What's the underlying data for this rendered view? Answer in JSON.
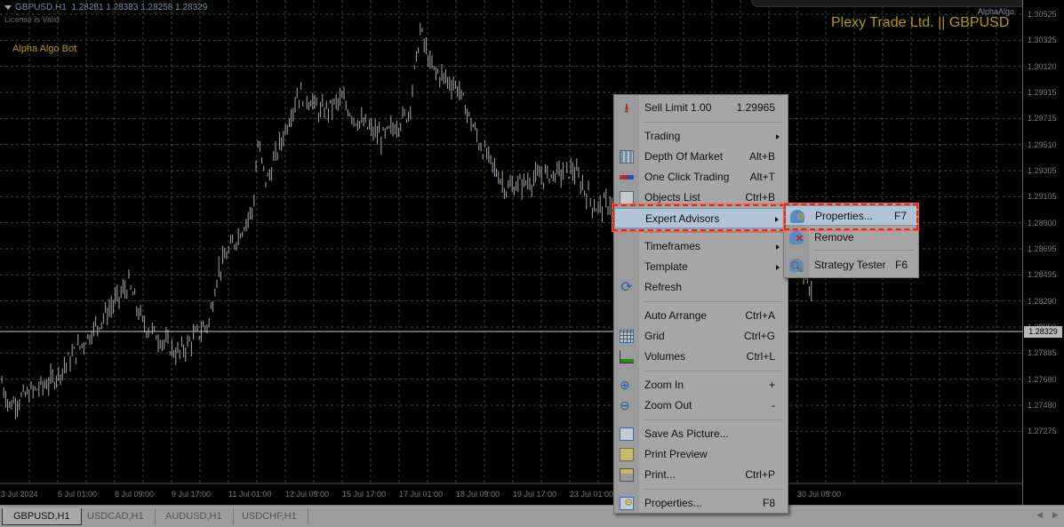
{
  "header": {
    "symbol": "GBPUSD,H1",
    "ohlc": "1.28281 1.28383 1.28258 1.28329",
    "license": "License is Valid",
    "bot_name": "Alpha Algo Bot",
    "brand": "Plexy Trade Ltd. || GBPUSD",
    "indicator_name": "AlphaAlgo"
  },
  "price_axis": [
    "1.30525",
    "1.30325",
    "1.30120",
    "1.29915",
    "1.29715",
    "1.29510",
    "1.29305",
    "1.29105",
    "1.28900",
    "1.28695",
    "1.28495",
    "1.28290",
    "1.28090",
    "1.27885",
    "1.27680",
    "1.27480",
    "1.27275"
  ],
  "current_price": "1.28329",
  "time_axis": [
    "3 Jul 2024",
    "5 Jul 01:00",
    "8 Jul 09:00",
    "9 Jul 17:00",
    "11 Jul 01:00",
    "12 Jul 09:00",
    "15 Jul 17:00",
    "17 Jul 01:00",
    "18 Jul 09:00",
    "19 Jul 17:00",
    "23 Jul 01:00",
    "30 Jul 09:00"
  ],
  "price_path": [
    [
      0,
      1.2768
    ],
    [
      10,
      1.2745
    ],
    [
      60,
      1.2765
    ],
    [
      100,
      1.28
    ],
    [
      145,
      1.284
    ],
    [
      160,
      1.281
    ],
    [
      200,
      1.2785
    ],
    [
      235,
      1.281
    ],
    [
      245,
      1.285
    ],
    [
      285,
      1.29
    ],
    [
      290,
      1.295
    ],
    [
      300,
      1.292
    ],
    [
      335,
      1.299
    ],
    [
      350,
      1.2985
    ],
    [
      360,
      1.2975
    ],
    [
      385,
      1.2985
    ],
    [
      400,
      1.297
    ],
    [
      430,
      1.2955
    ],
    [
      460,
      1.2975
    ],
    [
      473,
      1.304
    ],
    [
      485,
      1.301
    ],
    [
      515,
      1.2995
    ],
    [
      540,
      1.295
    ],
    [
      570,
      1.2915
    ],
    [
      610,
      1.2925
    ],
    [
      645,
      1.293
    ],
    [
      670,
      1.29
    ],
    [
      690,
      1.2905
    ],
    [
      800,
      1.288
    ],
    [
      900,
      1.286
    ],
    [
      915,
      1.2825
    ]
  ],
  "tabs": [
    "GBPUSD,H1",
    "USDCAD,H1",
    "AUDUSD,H1",
    "USDCHF,H1"
  ],
  "context_menu": {
    "sell_limit": {
      "label": "Sell Limit 1.00",
      "value": "1.29965",
      "icon": "sell-arrow-icon"
    },
    "trading": {
      "label": "Trading"
    },
    "depth": {
      "label": "Depth Of Market",
      "shortcut": "Alt+B"
    },
    "one_click": {
      "label": "One Click Trading",
      "shortcut": "Alt+T"
    },
    "objects": {
      "label": "Objects List",
      "shortcut": "Ctrl+B"
    },
    "expert": {
      "label": "Expert Advisors"
    },
    "timeframes": {
      "label": "Timeframes"
    },
    "template": {
      "label": "Template"
    },
    "refresh": {
      "label": "Refresh"
    },
    "auto_arrange": {
      "label": "Auto Arrange",
      "shortcut": "Ctrl+A"
    },
    "grid": {
      "label": "Grid",
      "shortcut": "Ctrl+G"
    },
    "volumes": {
      "label": "Volumes",
      "shortcut": "Ctrl+L"
    },
    "zoom_in": {
      "label": "Zoom In",
      "shortcut": "+"
    },
    "zoom_out": {
      "label": "Zoom Out",
      "shortcut": "-"
    },
    "save_picture": {
      "label": "Save As Picture..."
    },
    "print_preview": {
      "label": "Print Preview"
    },
    "print": {
      "label": "Print...",
      "shortcut": "Ctrl+P"
    },
    "properties": {
      "label": "Properties...",
      "shortcut": "F8"
    }
  },
  "submenu": {
    "properties": {
      "label": "Properties...",
      "shortcut": "F7"
    },
    "remove": {
      "label": "Remove"
    },
    "strategy_tester": {
      "label": "Strategy Tester",
      "shortcut": "F6"
    }
  },
  "colors": {
    "highlight": "#e0281c",
    "brand_text": "#b39a00",
    "candles": "#a8a8a8"
  }
}
